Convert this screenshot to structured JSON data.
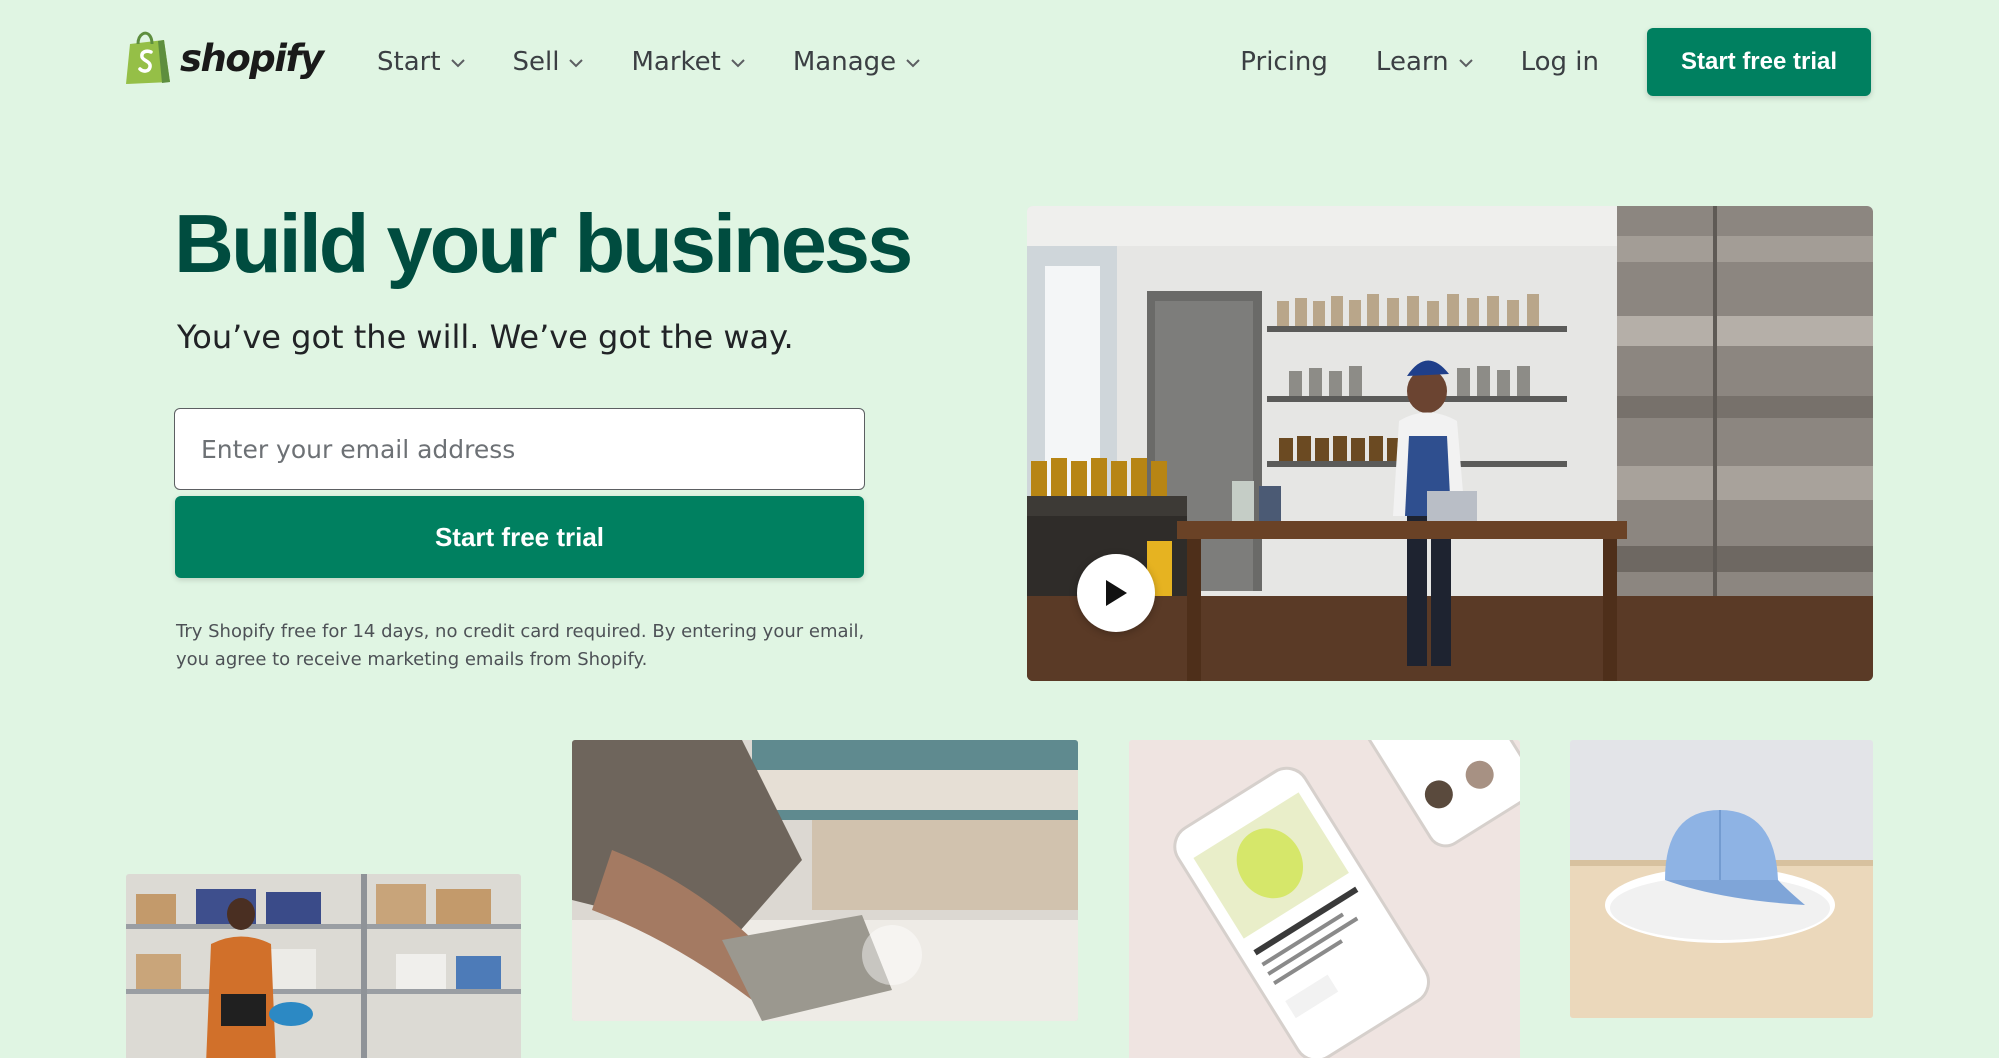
{
  "brand": {
    "name": "shopify",
    "accent_color": "#008060",
    "heading_color": "#004c3f",
    "background": "#e0f5e3"
  },
  "header": {
    "logo_text": "shopify",
    "nav_left": [
      {
        "label": "Start",
        "has_dropdown": true
      },
      {
        "label": "Sell",
        "has_dropdown": true
      },
      {
        "label": "Market",
        "has_dropdown": true
      },
      {
        "label": "Manage",
        "has_dropdown": true
      }
    ],
    "nav_right": [
      {
        "label": "Pricing",
        "has_dropdown": false
      },
      {
        "label": "Learn",
        "has_dropdown": true
      },
      {
        "label": "Log in",
        "has_dropdown": false
      }
    ],
    "cta_label": "Start free trial"
  },
  "hero": {
    "title": "Build your business",
    "subtitle": "You’ve got the will. We’ve got the way.",
    "email_placeholder": "Enter your email address",
    "email_value": "",
    "cta_label": "Start free trial",
    "disclaimer": "Try Shopify free for 14 days, no credit card required. By entering your email, you agree to receive marketing emails from Shopify."
  },
  "media": {
    "video_icon": "play-icon",
    "tiles": [
      "warehouse-photo",
      "woodworking-photo",
      "phone-storefront-photo",
      "baseball-cap-photo"
    ]
  }
}
